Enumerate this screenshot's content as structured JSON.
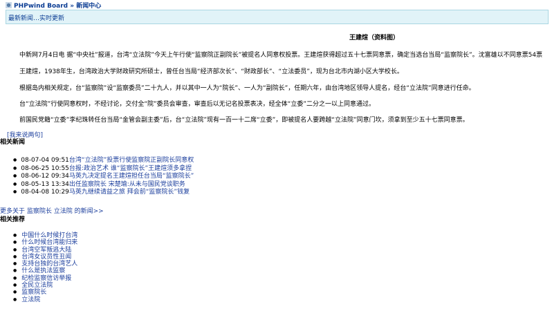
{
  "header": {
    "site_name": "PHPwind Board",
    "separator": "»",
    "section": "新闻中心",
    "subtitle": "最新新闻…实时更新"
  },
  "article": {
    "image_caption": "王建煊（资料图）",
    "paragraphs": [
      "中新网7月4日电 据“中央社”报道，台湾“立法院”今天上午行使“监察院正副院长”被提名人同意权投票。王建煊获得超过五十七票同意票，确定当选台当局“监察院长”。沈富雄以不同意票54票",
      "王建煊，1938年生，台湾政治大学财政研究所硕士，曾任台当局“经济部次长”、“财政部长”、“立法委员”，现为台北市内湖小区大学校长。",
      "根据岛内相关规定，台“监察院”设“监察委员”二十九人，并以其中一人为“院长”、一人为“副院长”，任期六年，由台湾地区领导人提名，经台“立法院”同意进行任命。",
      "台“立法院”行使同意权时，不经讨论，交付全“院”委员会审查，审查后以无记名投票表决，经全体“立委”二分之一以上同意通过。",
      "前国民党籍“立委”李纪珠转任台当局“金管会副主委”后，台“立法院”现有一百一十二席“立委”，即被提名人要跨越“立法院”同意门坎，须拿到至少五十七票同意票。"
    ]
  },
  "comment_link": "[我来说两句]",
  "related_news": {
    "title": "相关新闻",
    "items": [
      {
        "date": "08-07-04 09:51",
        "title": "台湾“立法院”投票行使监察院正副院长同意权"
      },
      {
        "date": "08-06-25 10:55",
        "title": "台报:政治艺术 谁“监察院长”王建煊须多拿捏"
      },
      {
        "date": "08-06-12 09:34",
        "title": "马英九决定提名王建煊担任台当局“监察院长”"
      },
      {
        "date": "08-05-13 13:34",
        "title": "出任监察院长 宋楚瑜:从未与国民党谈职务"
      },
      {
        "date": "08-04-08 10:29",
        "title": "马英九继续请益之旅 拜会前“监察院长”钱复"
      }
    ],
    "more_prefix": "更多关于",
    "more_keywords": "监察院长 立法院",
    "more_suffix": "的新闻>>"
  },
  "related_recommend": {
    "title": "相关推荐",
    "items": [
      "中国什么时候打台湾",
      "什么时候台湾能归来",
      "台湾空军叛逃大陆",
      "台湾女议员性丑闻",
      "支持台独的台湾艺人",
      "什么是执法监察",
      "纪检监察信访举报",
      "全民立法院",
      "监察院长",
      "立法院"
    ]
  }
}
